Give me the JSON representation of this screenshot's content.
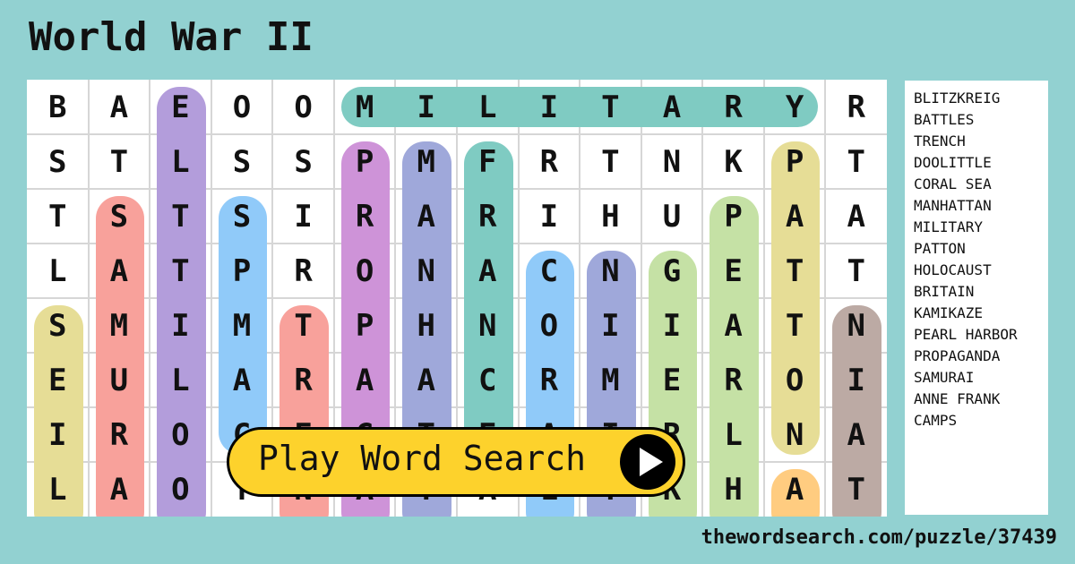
{
  "title": "World War II",
  "grid": [
    [
      "B",
      "A",
      "E",
      "O",
      "O",
      "M",
      "I",
      "L",
      "I",
      "T",
      "A",
      "R",
      "Y",
      "R"
    ],
    [
      "S",
      "T",
      "L",
      "S",
      "S",
      "P",
      "M",
      "F",
      "R",
      "T",
      "N",
      "K",
      "P",
      "T"
    ],
    [
      "T",
      "S",
      "T",
      "S",
      "I",
      "R",
      "A",
      "R",
      "I",
      "H",
      "U",
      "P",
      "A",
      "A"
    ],
    [
      "L",
      "A",
      "T",
      "P",
      "R",
      "O",
      "N",
      "A",
      "C",
      "N",
      "G",
      "E",
      "T",
      "T"
    ],
    [
      "S",
      "M",
      "I",
      "M",
      "T",
      "P",
      "H",
      "N",
      "O",
      "I",
      "I",
      "A",
      "T",
      "N"
    ],
    [
      "E",
      "U",
      "L",
      "A",
      "R",
      "A",
      "A",
      "C",
      "R",
      "M",
      "E",
      "R",
      "O",
      "I"
    ],
    [
      "I",
      "R",
      "O",
      "C",
      "E",
      "G",
      "T",
      "E",
      "A",
      "I",
      "R",
      "L",
      "N",
      "A"
    ],
    [
      "L",
      "A",
      "O",
      "T",
      "N",
      "A",
      "T",
      "A",
      "L",
      "T",
      "K",
      "H",
      "A",
      "T"
    ]
  ],
  "highlights": [
    {
      "word": "MILITARY",
      "row": 0,
      "col_start": 5,
      "col_end": 12,
      "dir": "h",
      "color": "#7fcbc2"
    },
    {
      "word": "col0",
      "col": 0,
      "row_start": 4,
      "row_end": 7,
      "dir": "v",
      "color": "#e6dd96"
    },
    {
      "word": "SAMURAI",
      "col": 1,
      "row_start": 2,
      "row_end": 7,
      "dir": "v",
      "color": "#f8a19b"
    },
    {
      "word": "DOOLITTLE",
      "col": 2,
      "row_start": 0,
      "row_end": 7,
      "dir": "v",
      "color": "#b39ddb"
    },
    {
      "word": "CAMPS",
      "col": 3,
      "row_start": 2,
      "row_end": 6,
      "dir": "v",
      "color": "#90caf9"
    },
    {
      "word": "TRENCH",
      "col": 4,
      "row_start": 4,
      "row_end": 7,
      "dir": "v",
      "color": "#f8a19b"
    },
    {
      "word": "PROPAGANDA",
      "col": 5,
      "row_start": 1,
      "row_end": 7,
      "dir": "v",
      "color": "#ce93d8"
    },
    {
      "word": "MANHATTAN",
      "col": 6,
      "row_start": 1,
      "row_end": 7,
      "dir": "v",
      "color": "#9fa8da"
    },
    {
      "word": "FRANCE",
      "col": 7,
      "row_start": 1,
      "row_end": 6,
      "dir": "v",
      "color": "#7fcbc2"
    },
    {
      "word": "CORAL SEA",
      "col": 8,
      "row_start": 3,
      "row_end": 7,
      "dir": "v",
      "color": "#90caf9"
    },
    {
      "word": "col9",
      "col": 9,
      "row_start": 3,
      "row_end": 7,
      "dir": "v",
      "color": "#9fa8da"
    },
    {
      "word": "BLITZKRIEG",
      "col": 10,
      "row_start": 3,
      "row_end": 7,
      "dir": "v",
      "color": "#c5e1a5"
    },
    {
      "word": "PEARL HARBOR",
      "col": 11,
      "row_start": 2,
      "row_end": 7,
      "dir": "v",
      "color": "#c5e1a5"
    },
    {
      "word": "PATTON",
      "col": 12,
      "row_start": 1,
      "row_end": 6,
      "dir": "v",
      "color": "#e6dd96"
    },
    {
      "word": "col12b",
      "col": 12,
      "row_start": 7,
      "row_end": 7,
      "dir": "v",
      "color": "#ffcc80"
    },
    {
      "word": "BRITAIN",
      "col": 13,
      "row_start": 4,
      "row_end": 7,
      "dir": "v",
      "color": "#bcaaa4"
    }
  ],
  "word_list": [
    "BLITZKREIG",
    "BATTLES",
    "TRENCH",
    "DOOLITTLE",
    "CORAL SEA",
    "MANHATTAN",
    "MILITARY",
    "PATTON",
    "HOLOCAUST",
    "BRITAIN",
    "KAMIKAZE",
    "PEARL HARBOR",
    "PROPAGANDA",
    "SAMURAI",
    "ANNE FRANK",
    "CAMPS"
  ],
  "play_button": {
    "label": "Play Word Search",
    "icon": "play-icon"
  },
  "footer": "thewordsearch.com/puzzle/37439"
}
